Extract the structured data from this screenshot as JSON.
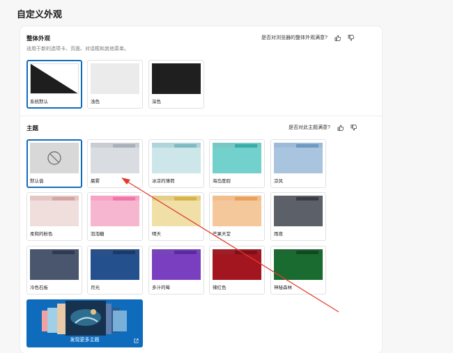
{
  "page_title": "自定义外观",
  "appearance": {
    "title": "整体外观",
    "subtitle": "适用于新的选项卡、页面、对话框和其他菜单。",
    "feedback_question": "是否对浏览器的整体外观满意?",
    "options": [
      {
        "label": "系统默认",
        "selected": true
      },
      {
        "label": "浅色",
        "selected": false
      },
      {
        "label": "深色",
        "selected": false
      }
    ]
  },
  "themes": {
    "title": "主题",
    "feedback_question": "是否对此主题满意?",
    "items": [
      {
        "label": "默认值",
        "selected": true,
        "tab": "",
        "body": "#d8d8d8",
        "bg": "#d8d8d8"
      },
      {
        "label": "晨雾",
        "selected": false,
        "tab": "#a9b0b9",
        "body": "#d9dde2",
        "bg": "#eef0f3"
      },
      {
        "label": "冰凉的薄荷",
        "selected": false,
        "tab": "#7fb9c2",
        "body": "#cde6ea",
        "bg": "#e9f4f5"
      },
      {
        "label": "海岛度假",
        "selected": false,
        "tab": "#38aca8",
        "body": "#72d1cc",
        "bg": "#c9ecea"
      },
      {
        "label": "凉风",
        "selected": false,
        "tab": "#6e99c2",
        "body": "#a9c4df",
        "bg": "#d7e4f1"
      },
      {
        "label": "柔和的粉色",
        "selected": false,
        "tab": "#d4a5a4",
        "body": "#f0dedd",
        "bg": "#f8eeee"
      },
      {
        "label": "泡泡糖",
        "selected": false,
        "tab": "#f274a9",
        "body": "#f7b6cf",
        "bg": "#fbdbe8"
      },
      {
        "label": "晴天",
        "selected": false,
        "tab": "#d5b44a",
        "body": "#f0dfa6",
        "bg": "#f8efd3"
      },
      {
        "label": "芒果天堂",
        "selected": false,
        "tab": "#e9a05b",
        "body": "#f5c89b",
        "bg": "#fae3cd"
      },
      {
        "label": "雨夜",
        "selected": false,
        "tab": "#3a3d44",
        "body": "#5c6069",
        "bg": "#8a8e96"
      },
      {
        "label": "冷色石板",
        "selected": false,
        "tab": "#2f3b52",
        "body": "#4a566d",
        "bg": "#6c7891"
      },
      {
        "label": "月光",
        "selected": false,
        "tab": "#1b3a68",
        "body": "#24508e",
        "bg": "#3e6aa8"
      },
      {
        "label": "多汁的莓",
        "selected": false,
        "tab": "#5a2a9e",
        "body": "#7a3fc0",
        "bg": "#9a66d4"
      },
      {
        "label": "辣红色",
        "selected": false,
        "tab": "#7d1018",
        "body": "#a3151f",
        "bg": "#c0323c"
      },
      {
        "label": "神秘森林",
        "selected": false,
        "tab": "#114a22",
        "body": "#1a6b30",
        "bg": "#2f8a48"
      }
    ],
    "promo_label": "发现更多主题"
  },
  "colors": {
    "accent": "#0f6cbd",
    "annotation_arrow": "#e23b2e"
  }
}
